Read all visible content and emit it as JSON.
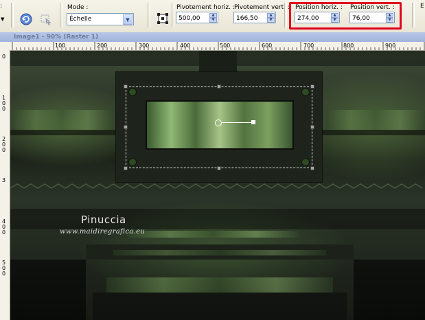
{
  "toolbar": {
    "mode_label": "Mode :",
    "mode_value": "Échelle",
    "pivot_h_label": "Pivotement horiz. :",
    "pivot_h_value": "500,00",
    "pivot_v_label": "Pivotement vert. :",
    "pivot_v_value": "166,50",
    "pos_h_label": "Position horiz. :",
    "pos_h_value": "274,00",
    "pos_v_label": "Position vert. :",
    "pos_v_value": "76,00",
    "icons": [
      "reset-icon",
      "pick-tool-icon",
      "scale-mode-icon",
      "chevron-down-icon"
    ]
  },
  "window": {
    "title": "Image1 - 90% (Raster 1)"
  },
  "ruler": {
    "h_ticks": [
      "100",
      "200",
      "300",
      "400",
      "500",
      "600",
      "700",
      "800",
      "900"
    ],
    "v_ticks": [
      "0",
      "1\n0\n0",
      "2\n0\n0",
      "3",
      "4\n0\n0",
      "5\n0\n0"
    ]
  },
  "watermark": {
    "name": "Pinuccia",
    "url": "www.maidiregrafica.eu"
  },
  "colors": {
    "highlight": "#e0001b",
    "accent_green": "#7aa25c"
  }
}
